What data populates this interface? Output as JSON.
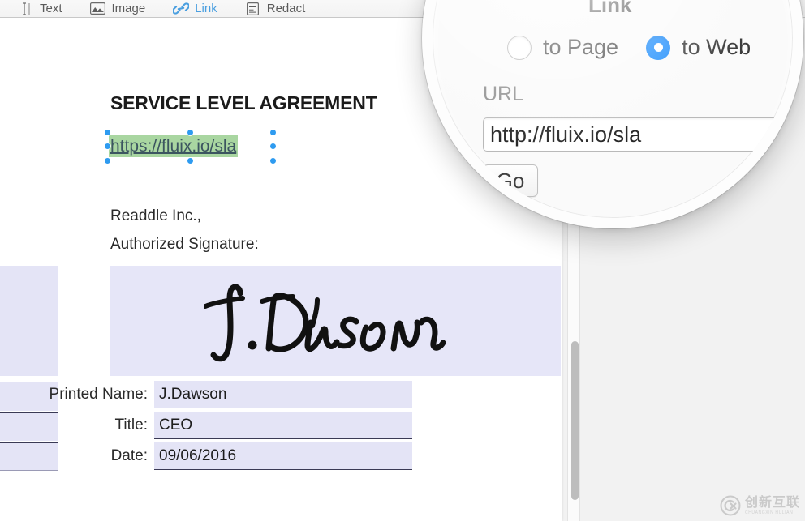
{
  "toolbar": {
    "items": [
      {
        "label": "Text",
        "icon": "text-cursor-icon",
        "active": false
      },
      {
        "label": "Image",
        "icon": "image-icon",
        "active": false
      },
      {
        "label": "Link",
        "icon": "link-icon",
        "active": true
      },
      {
        "label": "Redact",
        "icon": "redact-icon",
        "active": false
      }
    ]
  },
  "document": {
    "title": "SERVICE LEVEL AGREEMENT",
    "link_text": "https://fluix.io/sla",
    "company_line": "Readdle Inc.,",
    "signature_line": "Authorized Signature:",
    "signature_name": "J.Dawson",
    "fields": [
      {
        "label": "Printed Name:",
        "value": "J.Dawson"
      },
      {
        "label": "Title:",
        "value": "CEO"
      },
      {
        "label": "Date:",
        "value": "09/06/2016"
      }
    ]
  },
  "link_popover": {
    "title": "Link",
    "options": [
      {
        "label": "to Page",
        "selected": false
      },
      {
        "label": "to Web",
        "selected": true
      }
    ],
    "url_label": "URL",
    "url_value": "http://fluix.io/sla",
    "url_placeholder": "http://",
    "go_label": "Go"
  },
  "watermark": {
    "cn": "创新互联",
    "en": "CHUANGXIN HULIAN"
  },
  "colors": {
    "accent_blue": "#1a8cfd",
    "tool_active": "#4a9fe0",
    "link_highlight": "#a9d6a1",
    "field_fill": "#e4e4f6",
    "handle": "#2e9bf0"
  }
}
